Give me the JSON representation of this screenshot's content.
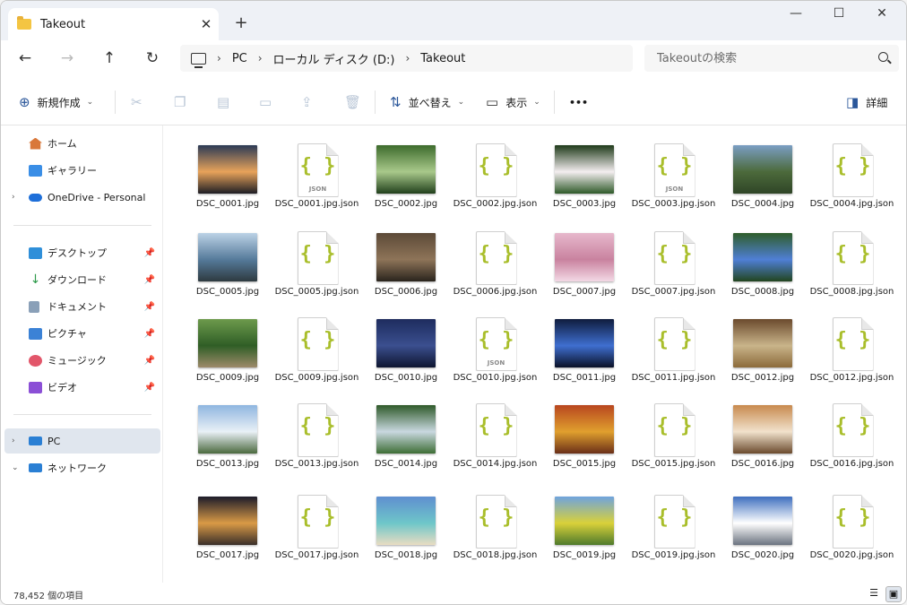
{
  "window": {
    "title": "Takeout",
    "newtab_label": "+",
    "close_tab": "✕",
    "minimize": "—",
    "maximize": "☐",
    "close": "✕"
  },
  "address": {
    "crumbs": [
      "PC",
      "ローカル ディスク (D:)",
      "Takeout"
    ],
    "search_placeholder": "Takeoutの検索"
  },
  "toolbar": {
    "new": "新規作成",
    "sort": "並べ替え",
    "view": "表示",
    "more": "•••",
    "details": "詳細"
  },
  "sidebar": {
    "top": [
      {
        "label": "ホーム",
        "icon": "home-icon"
      },
      {
        "label": "ギャラリー",
        "icon": "gallery-icon"
      },
      {
        "label": "OneDrive - Personal",
        "icon": "onedrive-icon"
      }
    ],
    "quick": [
      {
        "label": "デスクトップ",
        "icon": "desktop-icon"
      },
      {
        "label": "ダウンロード",
        "icon": "download-icon"
      },
      {
        "label": "ドキュメント",
        "icon": "document-icon"
      },
      {
        "label": "ピクチャ",
        "icon": "pictures-icon"
      },
      {
        "label": "ミュージック",
        "icon": "music-icon"
      },
      {
        "label": "ビデオ",
        "icon": "video-icon"
      }
    ],
    "bottom": [
      {
        "label": "PC",
        "icon": "pc-icon"
      },
      {
        "label": "ネットワーク",
        "icon": "network-icon"
      }
    ]
  },
  "files": [
    {
      "name": "DSC_0001.jpg",
      "kind": "image",
      "colors": [
        "#2b3a55",
        "#e8a35a",
        "#1d1d24"
      ]
    },
    {
      "name": "DSC_0001.jpg.json",
      "kind": "json",
      "tag": "JSON"
    },
    {
      "name": "DSC_0002.jpg",
      "kind": "image",
      "colors": [
        "#3d6b2c",
        "#a9c98b",
        "#21401c"
      ]
    },
    {
      "name": "DSC_0002.jpg.json",
      "kind": "json",
      "tag": ""
    },
    {
      "name": "DSC_0003.jpg",
      "kind": "image",
      "colors": [
        "#1f3a1a",
        "#f4eef0",
        "#2f5a2a"
      ]
    },
    {
      "name": "DSC_0003.jpg.json",
      "kind": "json",
      "tag": "JSON"
    },
    {
      "name": "DSC_0004.jpg",
      "kind": "image",
      "colors": [
        "#7b9ec4",
        "#4c6a3b",
        "#2f4527"
      ]
    },
    {
      "name": "DSC_0004.jpg.json",
      "kind": "json",
      "tag": ""
    },
    {
      "name": "DSC_0005.jpg",
      "kind": "image",
      "colors": [
        "#bcd2e6",
        "#557a9a",
        "#2e3a40"
      ]
    },
    {
      "name": "DSC_0005.jpg.json",
      "kind": "json",
      "tag": ""
    },
    {
      "name": "DSC_0006.jpg",
      "kind": "image",
      "colors": [
        "#5c4a38",
        "#8e7458",
        "#2a241d"
      ]
    },
    {
      "name": "DSC_0006.jpg.json",
      "kind": "json",
      "tag": ""
    },
    {
      "name": "DSC_0007.jpg",
      "kind": "image",
      "colors": [
        "#e7b8cc",
        "#c9829f",
        "#f3d9e5"
      ]
    },
    {
      "name": "DSC_0007.jpg.json",
      "kind": "json",
      "tag": ""
    },
    {
      "name": "DSC_0008.jpg",
      "kind": "image",
      "colors": [
        "#2f5d2a",
        "#4f7fd6",
        "#22451f"
      ]
    },
    {
      "name": "DSC_0008.jpg.json",
      "kind": "json",
      "tag": ""
    },
    {
      "name": "DSC_0009.jpg",
      "kind": "image",
      "colors": [
        "#6d9a4c",
        "#2f5e26",
        "#9d8a6a"
      ]
    },
    {
      "name": "DSC_0009.jpg.json",
      "kind": "json",
      "tag": ""
    },
    {
      "name": "DSC_0010.jpg",
      "kind": "image",
      "colors": [
        "#1e2c5e",
        "#3b4f8f",
        "#0e1530"
      ]
    },
    {
      "name": "DSC_0010.jpg.json",
      "kind": "json",
      "tag": "JSON"
    },
    {
      "name": "DSC_0011.jpg",
      "kind": "image",
      "colors": [
        "#0f1c3d",
        "#3f6fd0",
        "#0a1126"
      ]
    },
    {
      "name": "DSC_0011.jpg.json",
      "kind": "json",
      "tag": ""
    },
    {
      "name": "DSC_0012.jpg",
      "kind": "image",
      "colors": [
        "#6b4a2d",
        "#c9b48a",
        "#8b6a3a"
      ]
    },
    {
      "name": "DSC_0012.jpg.json",
      "kind": "json",
      "tag": ""
    },
    {
      "name": "DSC_0013.jpg",
      "kind": "image",
      "colors": [
        "#8fb6e0",
        "#e9f0f6",
        "#4b6a3e"
      ]
    },
    {
      "name": "DSC_0013.jpg.json",
      "kind": "json",
      "tag": ""
    },
    {
      "name": "DSC_0014.jpg",
      "kind": "image",
      "colors": [
        "#2f5a2a",
        "#c9d8e0",
        "#3e6e35"
      ]
    },
    {
      "name": "DSC_0014.jpg.json",
      "kind": "json",
      "tag": ""
    },
    {
      "name": "DSC_0015.jpg",
      "kind": "image",
      "colors": [
        "#b8461f",
        "#e0a02e",
        "#6a2f18"
      ]
    },
    {
      "name": "DSC_0015.jpg.json",
      "kind": "json",
      "tag": ""
    },
    {
      "name": "DSC_0016.jpg",
      "kind": "image",
      "colors": [
        "#c88a4e",
        "#f1e2cc",
        "#6b4a2d"
      ]
    },
    {
      "name": "DSC_0016.jpg.json",
      "kind": "json",
      "tag": ""
    },
    {
      "name": "DSC_0017.jpg",
      "kind": "image",
      "colors": [
        "#1c1b2a",
        "#d99a46",
        "#3a2f2a"
      ]
    },
    {
      "name": "DSC_0017.jpg.json",
      "kind": "json",
      "tag": ""
    },
    {
      "name": "DSC_0018.jpg",
      "kind": "image",
      "colors": [
        "#5f8fd0",
        "#6ec6c9",
        "#e8dcc2"
      ]
    },
    {
      "name": "DSC_0018.jpg.json",
      "kind": "json",
      "tag": ""
    },
    {
      "name": "DSC_0019.jpg",
      "kind": "image",
      "colors": [
        "#6fa3de",
        "#d9d13a",
        "#4f7a2c"
      ]
    },
    {
      "name": "DSC_0019.jpg.json",
      "kind": "json",
      "tag": ""
    },
    {
      "name": "DSC_0020.jpg",
      "kind": "image",
      "colors": [
        "#3f6fbf",
        "#ffffff",
        "#6b7380"
      ]
    },
    {
      "name": "DSC_0020.jpg.json",
      "kind": "json",
      "tag": ""
    }
  ],
  "status": {
    "count": "78,452 個の項目"
  },
  "colors": {
    "accent": "#2b579a",
    "json_brace": "#a9be2b",
    "selected": "#e0e6ee"
  }
}
